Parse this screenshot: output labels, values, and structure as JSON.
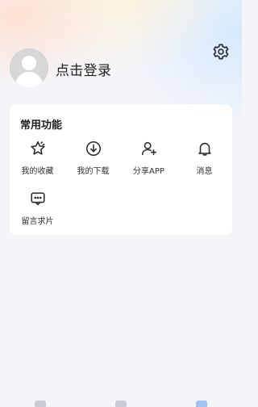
{
  "header": {
    "login_text": "点击登录"
  },
  "icons": {
    "avatar": "default-avatar",
    "settings": "gear-icon"
  },
  "features": {
    "title": "常用功能",
    "items": [
      {
        "label": "我的收藏",
        "icon": "star-icon"
      },
      {
        "label": "我的下载",
        "icon": "download-icon"
      },
      {
        "label": "分享APP",
        "icon": "add-user-icon"
      },
      {
        "label": "消息",
        "icon": "bell-icon"
      },
      {
        "label": "留言求片",
        "icon": "message-icon"
      }
    ]
  },
  "colors": {
    "background": "#f4f5f8",
    "card": "#ffffff",
    "text": "#1f1f1f"
  }
}
